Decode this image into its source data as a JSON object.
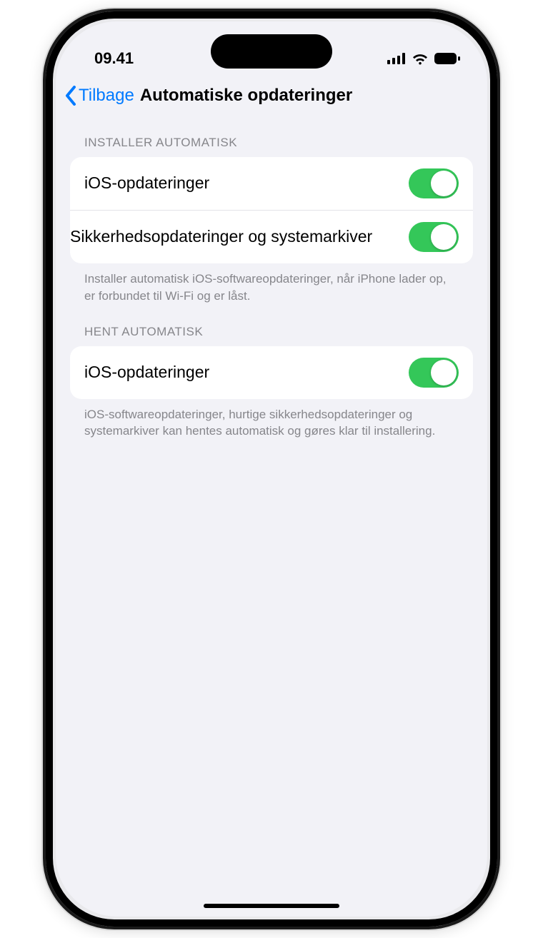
{
  "status": {
    "time": "09.41"
  },
  "nav": {
    "back": "Tilbage",
    "title": "Automatiske opdateringer"
  },
  "sections": [
    {
      "header": "INSTALLER AUTOMATISK",
      "rows": [
        {
          "label": "iOS-opdateringer",
          "on": true
        },
        {
          "label": "Sikkerhedsopdateringer og systemarkiver",
          "on": true
        }
      ],
      "footer": "Installer automatisk iOS-softwareopdateringer, når iPhone lader op, er forbundet til Wi-Fi og er låst."
    },
    {
      "header": "HENT AUTOMATISK",
      "rows": [
        {
          "label": "iOS-opdateringer",
          "on": true
        }
      ],
      "footer": "iOS-softwareopdateringer, hurtige sikkerhedsopdate­ringer og systemarkiver kan hentes automatisk og gøres klar til installering."
    }
  ],
  "colors": {
    "accent": "#007aff",
    "toggleOn": "#34c759",
    "background": "#f2f2f7"
  }
}
